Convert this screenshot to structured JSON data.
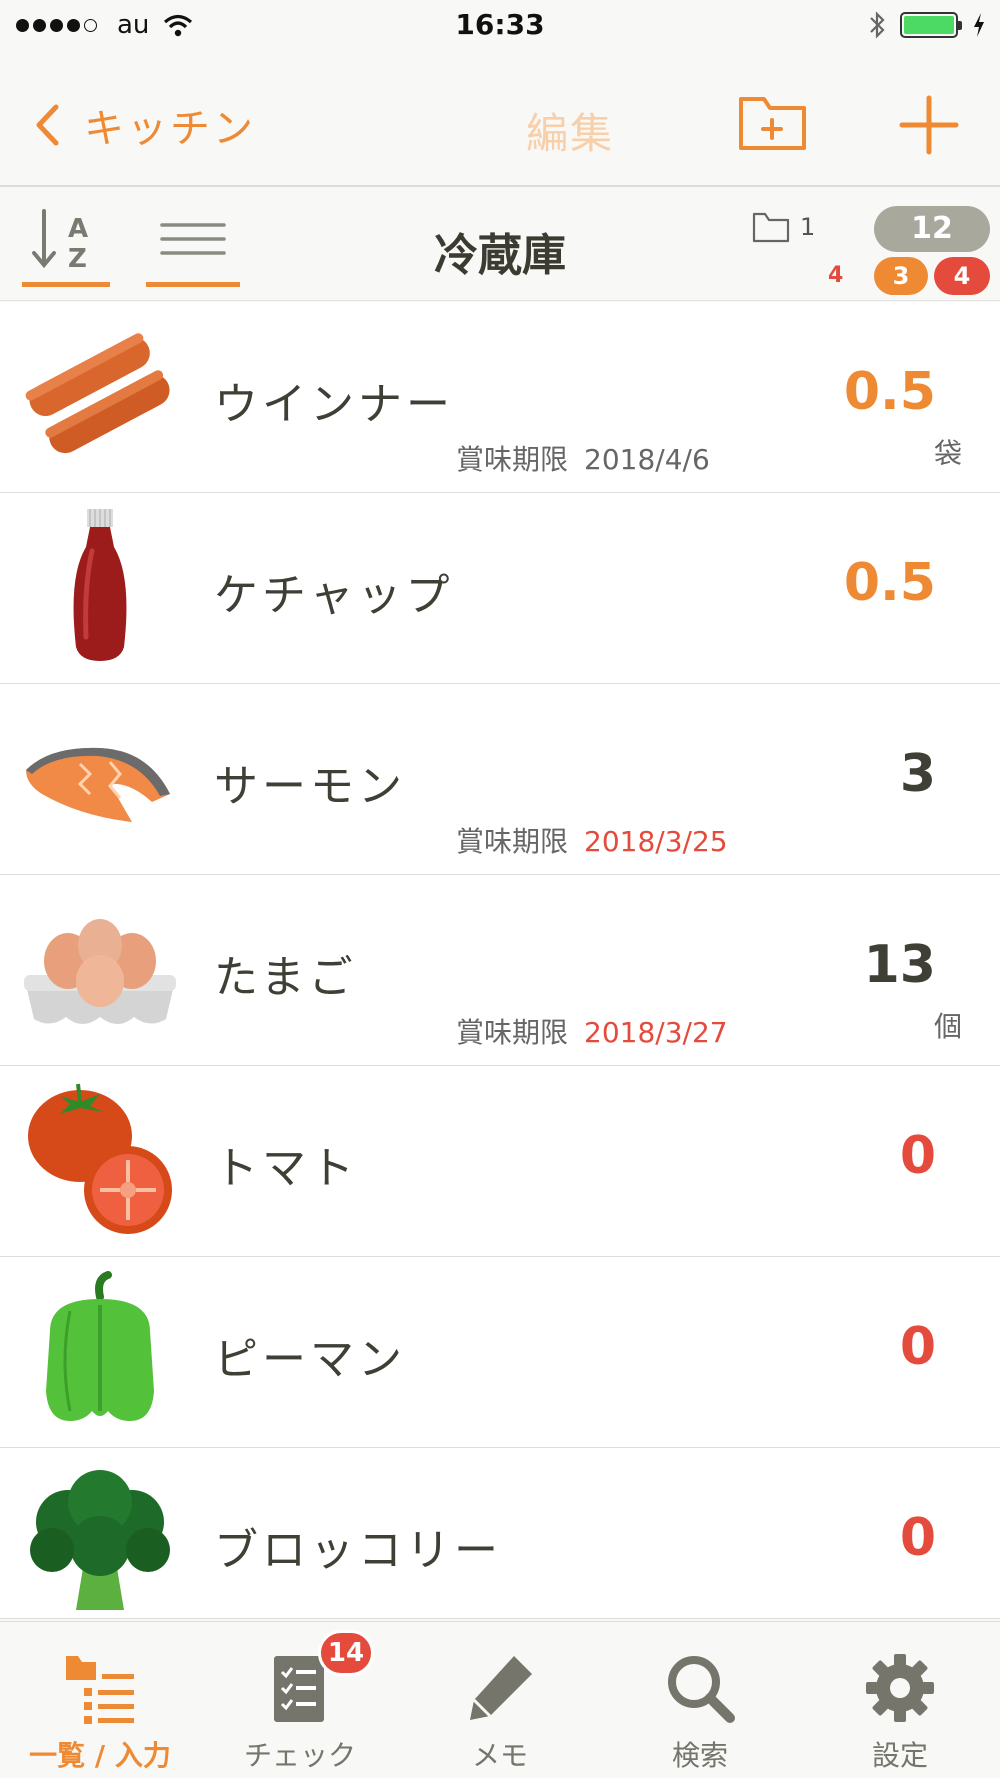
{
  "status_bar": {
    "carrier": "au",
    "time": "16:33"
  },
  "nav": {
    "back_label": "キッチン",
    "edit_label": "編集"
  },
  "toolbar": {
    "title": "冷蔵庫",
    "folder_count": "1",
    "total_count": "12",
    "warn_count": "4",
    "orange_count": "3",
    "red_count": "4"
  },
  "items": [
    {
      "name": "ウインナー",
      "qty": "0.5",
      "unit": "袋",
      "expiry_label": "賞味期限",
      "expiry": "2018/4/6",
      "qty_color": "orange",
      "expiry_color": "normal",
      "image": "sausage"
    },
    {
      "name": "ケチャップ",
      "qty": "0.5",
      "unit": "",
      "expiry_label": "",
      "expiry": "",
      "qty_color": "orange",
      "expiry_color": "normal",
      "image": "ketchup"
    },
    {
      "name": "サーモン",
      "qty": "3",
      "unit": "",
      "expiry_label": "賞味期限",
      "expiry": "2018/3/25",
      "qty_color": "dark",
      "expiry_color": "red",
      "image": "salmon"
    },
    {
      "name": "たまご",
      "qty": "13",
      "unit": "個",
      "expiry_label": "賞味期限",
      "expiry": "2018/3/27",
      "qty_color": "dark",
      "expiry_color": "red",
      "image": "eggs"
    },
    {
      "name": "トマト",
      "qty": "0",
      "unit": "",
      "expiry_label": "",
      "expiry": "",
      "qty_color": "red",
      "expiry_color": "normal",
      "image": "tomato"
    },
    {
      "name": "ピーマン",
      "qty": "0",
      "unit": "",
      "expiry_label": "",
      "expiry": "",
      "qty_color": "red",
      "expiry_color": "normal",
      "image": "green-pepper"
    },
    {
      "name": "ブロッコリー",
      "qty": "0",
      "unit": "",
      "expiry_label": "",
      "expiry": "",
      "qty_color": "red",
      "expiry_color": "normal",
      "image": "broccoli"
    }
  ],
  "tabs": [
    {
      "label": "一覧 / 入力",
      "icon": "list-folder-icon",
      "active": true
    },
    {
      "label": "チェック",
      "icon": "checklist-icon",
      "badge": "14"
    },
    {
      "label": "メモ",
      "icon": "pencil-icon"
    },
    {
      "label": "検索",
      "icon": "search-icon"
    },
    {
      "label": "設定",
      "icon": "gear-icon"
    }
  ],
  "colors": {
    "accent": "#ef8a34",
    "alert": "#e54b3c",
    "text": "#3f3f36"
  }
}
